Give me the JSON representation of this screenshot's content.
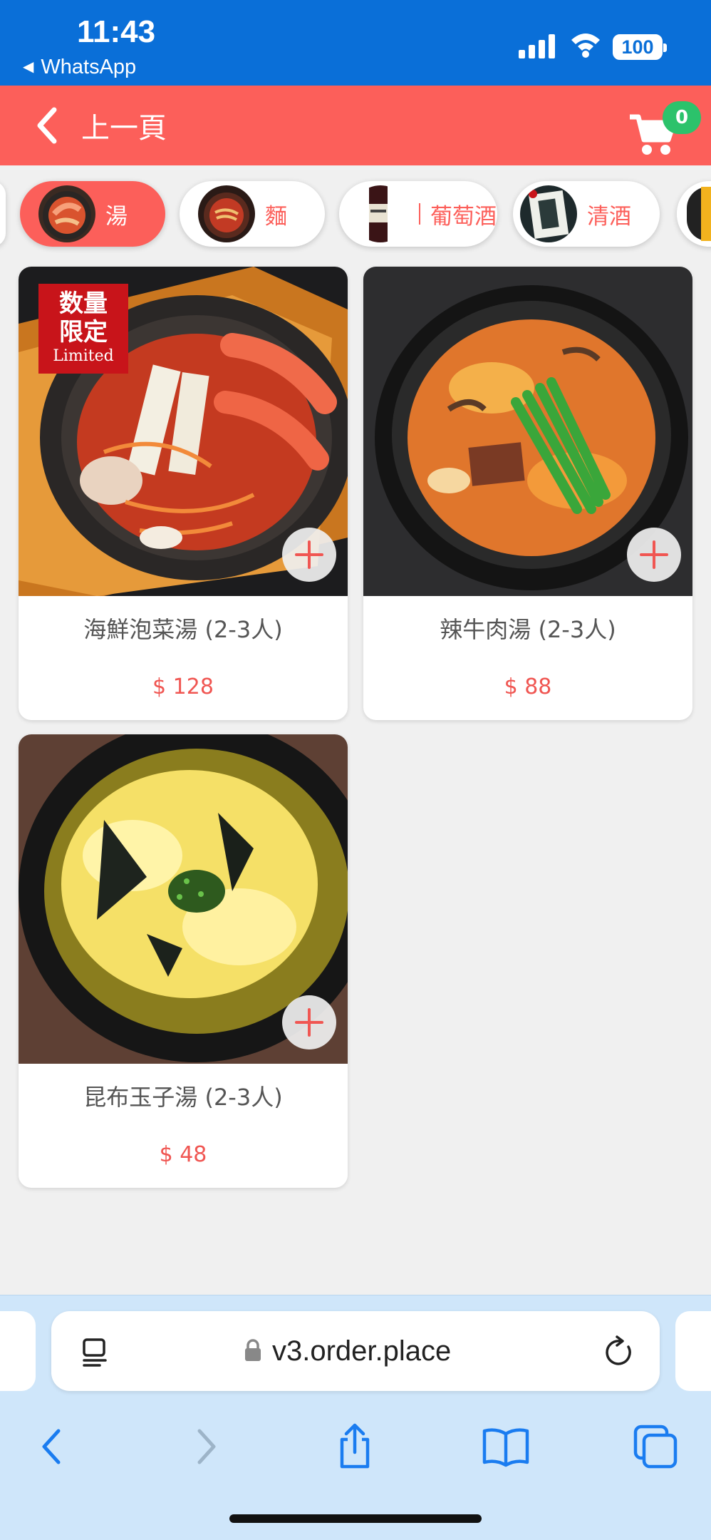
{
  "status_bar": {
    "time": "11:43",
    "back_app": "WhatsApp",
    "battery": "100"
  },
  "header": {
    "back_label": "上一頁",
    "cart_count": "0",
    "background_color": "#fc5f5a"
  },
  "categories": [
    {
      "label": "湯",
      "active": true,
      "icon": "soup-thumbnail"
    },
    {
      "label": "麵",
      "active": false,
      "icon": "noodles-thumbnail"
    },
    {
      "label": "葡萄酒",
      "active": false,
      "icon": "wine-bottle-thumbnail"
    },
    {
      "label": "清酒",
      "active": false,
      "icon": "sake-bottle-thumbnail"
    }
  ],
  "products": [
    {
      "name": "海鮮泡菜湯 (2-3人)",
      "price": "$ 128",
      "badge": [
        "数量",
        "限定",
        "Limited"
      ]
    },
    {
      "name": "辣牛肉湯 (2-3人)",
      "price": "$ 88"
    },
    {
      "name": "昆布玉子湯 (2-3人)",
      "price": "$ 48"
    }
  ],
  "browser": {
    "url": "v3.order.place",
    "accent_color": "#1a7cf0"
  }
}
